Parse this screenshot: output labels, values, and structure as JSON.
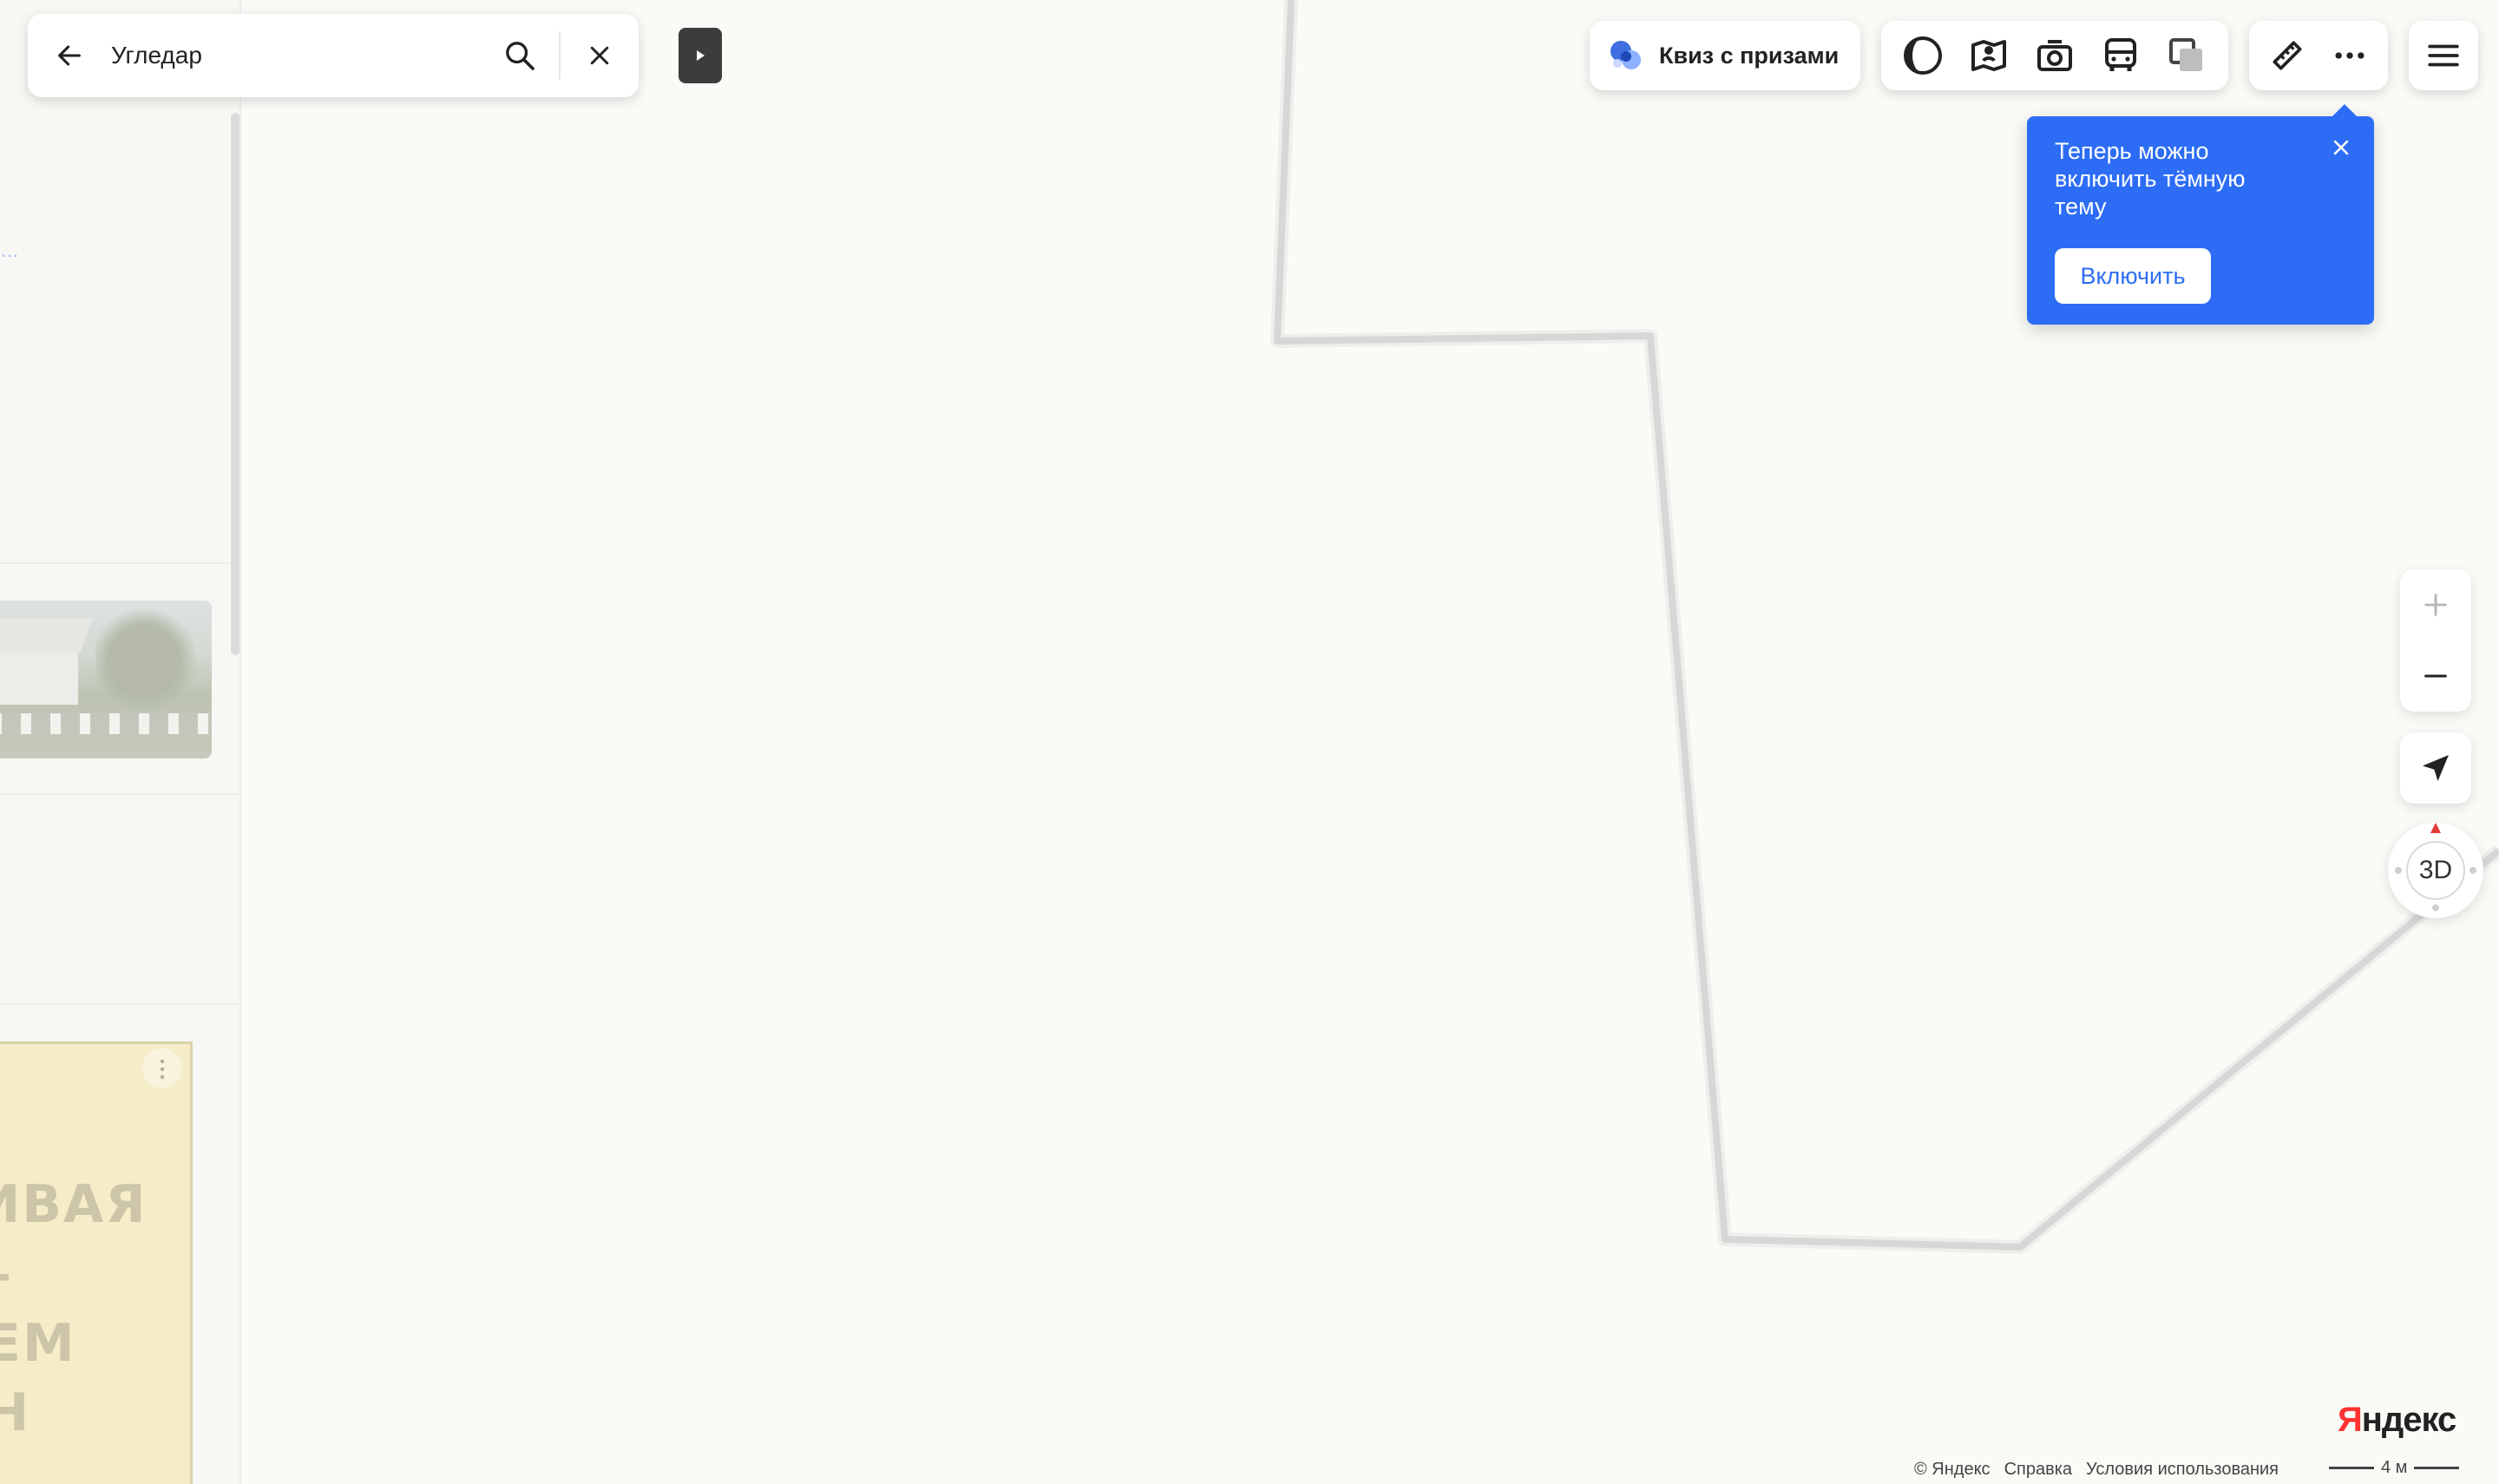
{
  "search": {
    "query": "Угледар"
  },
  "quiz_button": {
    "label": "Квиз с призами"
  },
  "tooltip": {
    "message": "Теперь можно включить тёмную тему",
    "enable_label": "Включить"
  },
  "compass": {
    "label": "3D"
  },
  "sidebar": {
    "poster_lines": [
      "ИВАЯ",
      "–",
      "ЕМ",
      "Н"
    ]
  },
  "footer": {
    "copyright": "© Яндекс",
    "help": "Справка",
    "terms": "Условия использования",
    "scale": "4 м"
  },
  "logo": {
    "first_letter": "Я",
    "rest": "ндекс"
  },
  "icons": {
    "back": "arrow-left-icon",
    "search": "search-icon",
    "clear": "close-icon",
    "collapse": "play-triangle-icon",
    "quiz": "quiz-icon",
    "layers": [
      "circle-layer-icon",
      "panorama-map-icon",
      "camera-icon",
      "bus-icon",
      "layers-square-icon"
    ],
    "tools": [
      "ruler-icon",
      "more-dots-icon"
    ],
    "menu": "hamburger-menu-icon",
    "zoom_in": "plus-icon",
    "zoom_out": "minus-icon",
    "locate": "location-arrow-icon"
  },
  "colors": {
    "accent": "#2d6df5",
    "map_background": "#fafaf7",
    "road": "#d8d7d5",
    "logo_red": "#ff3333"
  }
}
